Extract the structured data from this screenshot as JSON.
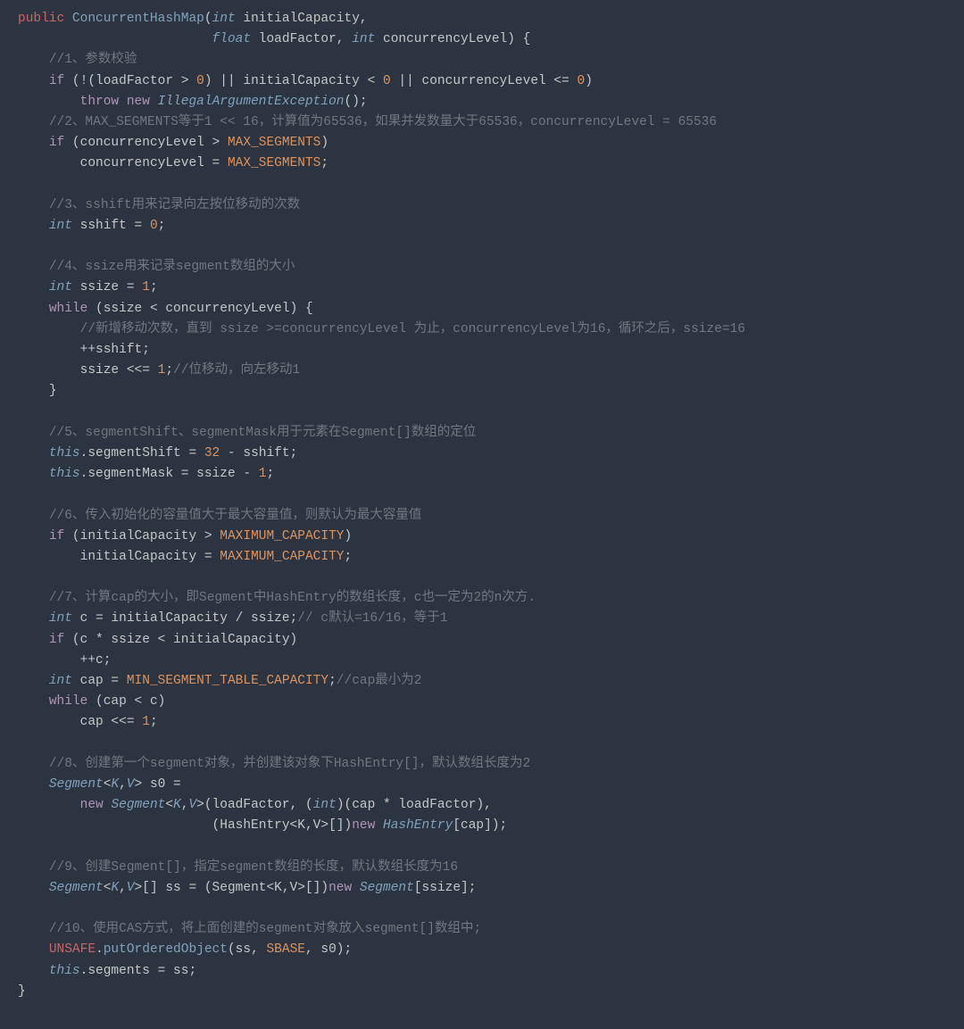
{
  "code": {
    "l01a": "public",
    "l01b": "ConcurrentHashMap",
    "l01c": "int",
    "l01d": "initialCapacity,",
    "l02a": "float",
    "l02b": "loadFactor,",
    "l02c": "int",
    "l02d": "concurrencyLevel) {",
    "l03": "//1、参数校验",
    "l04a": "if",
    "l04b": "(!(loadFactor >",
    "l04c": "0",
    "l04d": ") || initialCapacity <",
    "l04e": "0",
    "l04f": "|| concurrencyLevel <=",
    "l04g": "0",
    "l04h": ")",
    "l05a": "throw",
    "l05b": "new",
    "l05c": "IllegalArgumentException",
    "l05d": "();",
    "l06": "//2、MAX_SEGMENTS等于1 << 16，计算值为65536，如果并发数量大于65536，concurrencyLevel = 65536",
    "l07a": "if",
    "l07b": "(concurrencyLevel >",
    "l07c": "MAX_SEGMENTS",
    "l07d": ")",
    "l08a": "concurrencyLevel =",
    "l08b": "MAX_SEGMENTS",
    "l08c": ";",
    "l09": "",
    "l10": "//3、sshift用来记录向左按位移动的次数",
    "l11a": "int",
    "l11b": "sshift =",
    "l11c": "0",
    "l11d": ";",
    "l12": "",
    "l13": "//4、ssize用来记录segment数组的大小",
    "l14a": "int",
    "l14b": "ssize =",
    "l14c": "1",
    "l14d": ";",
    "l15a": "while",
    "l15b": "(ssize < concurrencyLevel) {",
    "l16": "//新增移动次数，直到 ssize >=concurrencyLevel 为止，concurrencyLevel为16，循环之后，ssize=16",
    "l17": "++sshift;",
    "l18a": "ssize <<=",
    "l18b": "1",
    "l18c": ";",
    "l18d": "//位移动，向左移动1",
    "l19": "}",
    "l20": "",
    "l21": "//5、segmentShift、segmentMask用于元素在Segment[]数组的定位",
    "l22a": "this",
    "l22b": ".segmentShift =",
    "l22c": "32",
    "l22d": "- sshift;",
    "l23a": "this",
    "l23b": ".segmentMask = ssize -",
    "l23c": "1",
    "l23d": ";",
    "l24": "",
    "l25": "//6、传入初始化的容量值大于最大容量值，则默认为最大容量值",
    "l26a": "if",
    "l26b": "(initialCapacity >",
    "l26c": "MAXIMUM_CAPACITY",
    "l26d": ")",
    "l27a": "initialCapacity =",
    "l27b": "MAXIMUM_CAPACITY",
    "l27c": ";",
    "l28": "",
    "l29": "//7、计算cap的大小，即Segment中HashEntry的数组长度，c也一定为2的n次方.",
    "l30a": "int",
    "l30b": "c = initialCapacity / ssize;",
    "l30c": "// c默认=16/16，等于1",
    "l31a": "if",
    "l31b": "(c * ssize < initialCapacity)",
    "l32": "++c;",
    "l33a": "int",
    "l33b": "cap =",
    "l33c": "MIN_SEGMENT_TABLE_CAPACITY",
    "l33d": ";",
    "l33e": "//cap最小为2",
    "l34a": "while",
    "l34b": "(cap < c)",
    "l35a": "cap <<=",
    "l35b": "1",
    "l35c": ";",
    "l36": "",
    "l37": "//8、创建第一个segment对象，并创建该对象下HashEntry[]，默认数组长度为2",
    "l38a": "Segment",
    "l38b": "<",
    "l38c": "K",
    "l38d": ",",
    "l38e": "V",
    "l38f": "> s0 =",
    "l39a": "new",
    "l39b": "Segment",
    "l39c": "<",
    "l39d": "K",
    "l39e": ",",
    "l39f": "V",
    "l39g": ">(loadFactor, (",
    "l39h": "int",
    "l39i": ")(cap * loadFactor),",
    "l40a": "(HashEntry<K,V>[])",
    "l40b": "new",
    "l40c": "HashEntry",
    "l40d": "[cap]);",
    "l41": "",
    "l42": "//9、创建Segment[]，指定segment数组的长度，默认数组长度为16",
    "l43a": "Segment",
    "l43b": "<",
    "l43c": "K",
    "l43d": ",",
    "l43e": "V",
    "l43f": ">[] ss = (Segment<K,V>[])",
    "l43g": "new",
    "l43h": "Segment",
    "l43i": "[ssize];",
    "l44": "",
    "l45": "//10、使用CAS方式，将上面创建的segment对象放入segment[]数组中;",
    "l46a": "UNSAFE",
    "l46b": ".",
    "l46c": "putOrderedObject",
    "l46d": "(ss,",
    "l46e": "SBASE",
    "l46f": ", s0);",
    "l47a": "this",
    "l47b": ".segments = ss;",
    "l48": "}"
  }
}
